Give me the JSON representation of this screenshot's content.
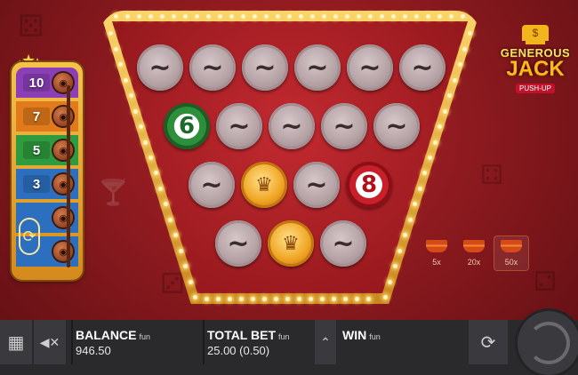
{
  "ladder": {
    "rungs": [
      {
        "label": "10",
        "color": "#8b3fb7"
      },
      {
        "label": "7",
        "color": "#e07a1a"
      },
      {
        "label": "5",
        "color": "#2e9b3e"
      },
      {
        "label": "3",
        "color": "#2d6fbf"
      },
      {
        "label": "",
        "color": "#2d6fbf"
      },
      {
        "label": "",
        "color": "#2d6fbf"
      }
    ]
  },
  "board": {
    "placeholder_symbol": "~",
    "rows": [
      [
        {
          "type": "blank"
        },
        {
          "type": "blank"
        },
        {
          "type": "blank"
        },
        {
          "type": "blank"
        },
        {
          "type": "blank"
        },
        {
          "type": "blank"
        }
      ],
      [
        {
          "type": "green",
          "value": "6"
        },
        {
          "type": "blank"
        },
        {
          "type": "blank"
        },
        {
          "type": "blank"
        },
        {
          "type": "blank"
        }
      ],
      [
        {
          "type": "blank"
        },
        {
          "type": "gold"
        },
        {
          "type": "blank"
        },
        {
          "type": "red",
          "value": "8"
        }
      ],
      [
        {
          "type": "blank"
        },
        {
          "type": "gold"
        },
        {
          "type": "blank"
        }
      ]
    ]
  },
  "logo": {
    "top": "GENEROUS",
    "main": "JACK",
    "sub": "PUSH-UP"
  },
  "multipliers": [
    {
      "label": "5x",
      "active": false
    },
    {
      "label": "20x",
      "active": false
    },
    {
      "label": "50x",
      "active": true
    }
  ],
  "bottom_bar": {
    "balance_label": "BALANCE",
    "balance_currency": "fun",
    "balance_value": "946.50",
    "total_bet_label": "TOTAL BET",
    "total_bet_currency": "fun",
    "total_bet_value": "25.00 (0.50)",
    "win_label": "WIN",
    "win_currency": "fun",
    "win_value": ""
  },
  "icons": {
    "menu": "grid-icon",
    "sound": "mute-icon",
    "bet_up": "chevron-up-icon",
    "autoplay": "autoplay-icon",
    "spin": "spin-icon"
  },
  "colors": {
    "background": "#8c1a1f",
    "frame_gold": "#f0b43a",
    "bar": "#2a2a2d"
  }
}
